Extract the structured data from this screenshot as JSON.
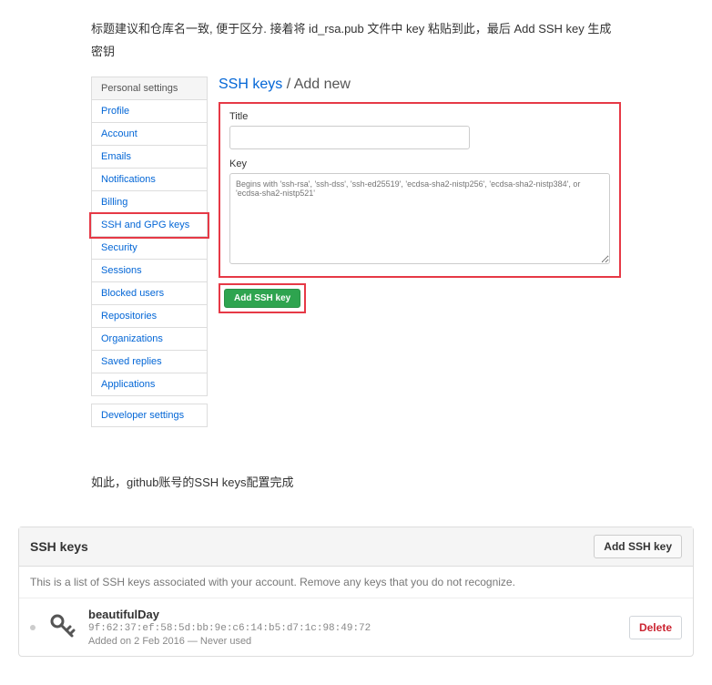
{
  "intro": "标题建议和仓库名一致, 便于区分. 接着将 id_rsa.pub 文件中 key 粘贴到此，最后 Add SSH key 生成密钥",
  "sidebar": {
    "header": "Personal settings",
    "items": [
      {
        "label": "Profile"
      },
      {
        "label": "Account"
      },
      {
        "label": "Emails"
      },
      {
        "label": "Notifications"
      },
      {
        "label": "Billing"
      },
      {
        "label": "SSH and GPG keys",
        "highlight": true
      },
      {
        "label": "Security"
      },
      {
        "label": "Sessions"
      },
      {
        "label": "Blocked users"
      },
      {
        "label": "Repositories"
      },
      {
        "label": "Organizations"
      },
      {
        "label": "Saved replies"
      },
      {
        "label": "Applications"
      }
    ],
    "footer_item": "Developer settings"
  },
  "breadcrumb": {
    "link": "SSH keys",
    "sep": " / ",
    "current": "Add new"
  },
  "form": {
    "title_label": "Title",
    "key_label": "Key",
    "key_placeholder": "Begins with 'ssh-rsa', 'ssh-dss', 'ssh-ed25519', 'ecdsa-sha2-nistp256', 'ecdsa-sha2-nistp384', or 'ecdsa-sha2-nistp521'",
    "add_button": "Add SSH key"
  },
  "mid_text": "如此，github账号的SSH keys配置完成",
  "panel": {
    "title": "SSH keys",
    "add_button": "Add SSH key",
    "description": "This is a list of SSH keys associated with your account. Remove any keys that you do not recognize.",
    "key": {
      "name": "beautifulDay",
      "fingerprint": "9f:62:37:ef:58:5d:bb:9e:c6:14:b5:d7:1c:98:49:72",
      "meta": "Added on 2 Feb 2016 — Never used"
    },
    "delete_button": "Delete"
  }
}
